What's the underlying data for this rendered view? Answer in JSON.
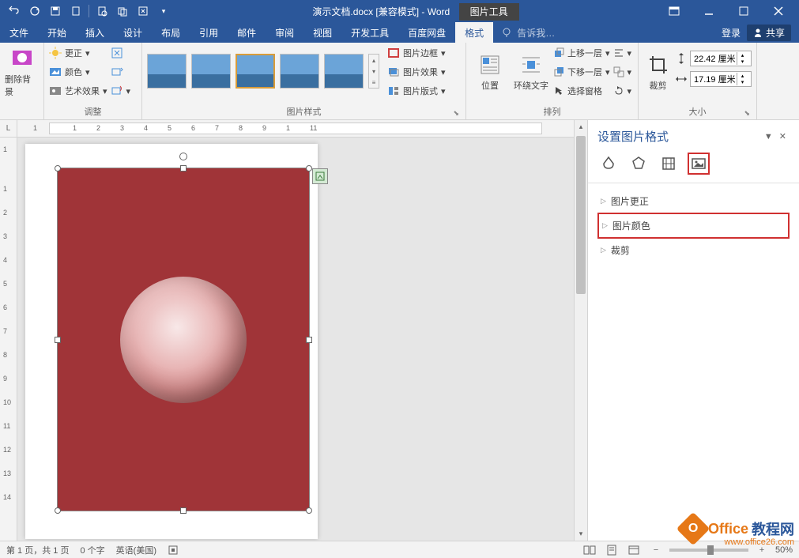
{
  "title": "演示文档.docx [兼容模式] - Word",
  "context_tab": "图片工具",
  "tabs": {
    "file": "文件",
    "home": "开始",
    "insert": "插入",
    "design": "设计",
    "layout": "布局",
    "references": "引用",
    "mailings": "邮件",
    "review": "审阅",
    "view": "视图",
    "developer": "开发工具",
    "baidu": "百度网盘",
    "format": "格式"
  },
  "tellme": "告诉我…",
  "login": "登录",
  "share": "共享",
  "ribbon": {
    "remove_bg": "删除背景",
    "adjust": {
      "label": "调整",
      "corrections": "更正",
      "color": "颜色",
      "artistic": "艺术效果"
    },
    "styles": {
      "label": "图片样式",
      "border": "图片边框",
      "effects": "图片效果",
      "layout": "图片版式"
    },
    "arrange": {
      "label": "排列",
      "position": "位置",
      "wrap": "环绕文字",
      "forward": "上移一层",
      "backward": "下移一层",
      "selection": "选择窗格"
    },
    "size": {
      "label": "大小",
      "crop": "裁剪",
      "height": "22.42 厘米",
      "width": "17.19 厘米"
    }
  },
  "ruler_h": [
    "1",
    "",
    "1",
    "2",
    "3",
    "4",
    "5",
    "6",
    "7",
    "8",
    "9",
    "1",
    "11"
  ],
  "ruler_v": [
    "",
    "1",
    "",
    "1",
    "2",
    "3",
    "4",
    "5",
    "6",
    "7",
    "8",
    "9",
    "10",
    "11",
    "12",
    "13",
    "14"
  ],
  "pane": {
    "title": "设置图片格式",
    "corrections": "图片更正",
    "color": "图片颜色",
    "crop": "裁剪"
  },
  "status": {
    "page": "第 1 页，共 1 页",
    "words": "0 个字",
    "lang": "英语(美国)",
    "zoom": "50%"
  },
  "watermark": {
    "brand1": "Office",
    "brand2": "教程网",
    "url": "www.office26.com"
  }
}
